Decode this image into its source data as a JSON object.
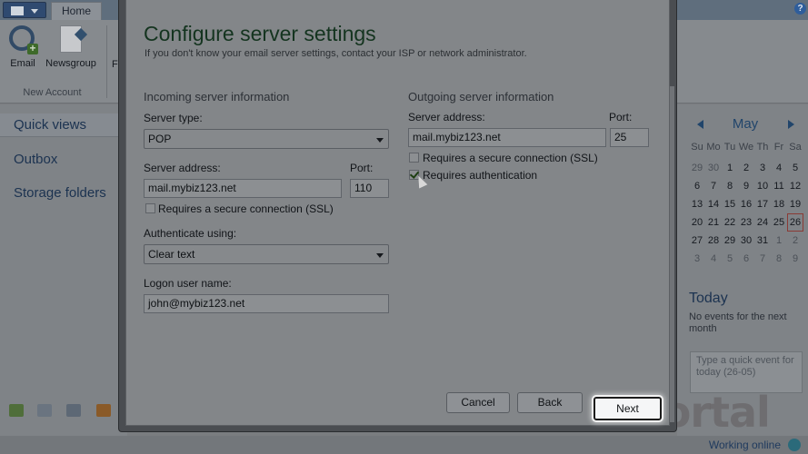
{
  "app": {
    "ribbon": {
      "tab_home": "Home",
      "email_label": "Email",
      "newsgroup_label": "Newsgroup",
      "feeds_label_partial": "F",
      "group_label": "New Account"
    },
    "nav": {
      "quick_views": "Quick views",
      "outbox": "Outbox",
      "storage_folders": "Storage folders"
    },
    "calendar": {
      "month": "May",
      "days_of_week": [
        "Su",
        "Mo",
        "Tu",
        "We",
        "Th",
        "Fr",
        "Sa"
      ],
      "weeks": [
        [
          "29",
          "30",
          "1",
          "2",
          "3",
          "4",
          "5"
        ],
        [
          "6",
          "7",
          "8",
          "9",
          "10",
          "11",
          "12"
        ],
        [
          "13",
          "14",
          "15",
          "16",
          "17",
          "18",
          "19"
        ],
        [
          "20",
          "21",
          "22",
          "23",
          "24",
          "25",
          "26"
        ],
        [
          "27",
          "28",
          "29",
          "30",
          "31",
          "1",
          "2"
        ],
        [
          "3",
          "4",
          "5",
          "6",
          "7",
          "8",
          "9"
        ]
      ],
      "today_value": "26",
      "today_title": "Today",
      "today_note": "No events for the next month",
      "quick_event_placeholder": "Type a quick event for today (26-05)"
    },
    "status": {
      "text": "Working online"
    },
    "watermark": "Portal"
  },
  "dialog": {
    "title": "Configure server settings",
    "subtitle": "If you don't know your email server settings, contact your ISP or network administrator.",
    "incoming": {
      "section_title": "Incoming server information",
      "server_type_label": "Server type:",
      "server_type_value": "POP",
      "server_address_label": "Server address:",
      "server_address_value": "mail.mybiz123.net",
      "port_label": "Port:",
      "port_value": "110",
      "ssl_label": "Requires a secure connection (SSL)",
      "ssl_checked": false,
      "auth_using_label": "Authenticate using:",
      "auth_using_value": "Clear text",
      "logon_label": "Logon user name:",
      "logon_value": "john@mybiz123.net"
    },
    "outgoing": {
      "section_title": "Outgoing server information",
      "server_address_label": "Server address:",
      "server_address_value": "mail.mybiz123.net",
      "port_label": "Port:",
      "port_value": "25",
      "ssl_label": "Requires a secure connection (SSL)",
      "ssl_checked": false,
      "auth_label": "Requires authentication",
      "auth_checked": true
    },
    "buttons": {
      "cancel": "Cancel",
      "back": "Back",
      "next": "Next"
    }
  },
  "colors": {
    "title_green": "#14341f",
    "accent_blue": "#21456b",
    "dim_overlay": "#7a7d80"
  }
}
